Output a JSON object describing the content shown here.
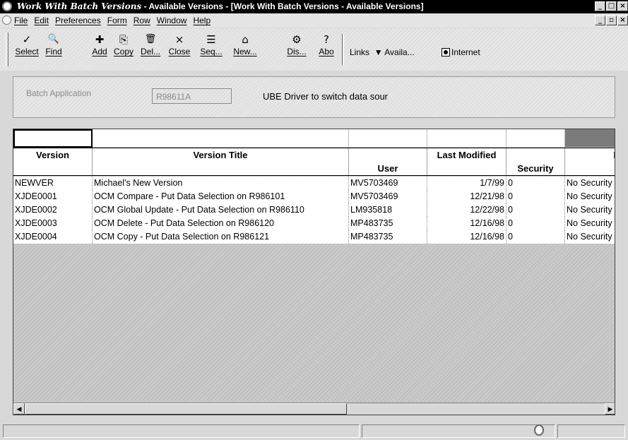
{
  "window": {
    "title_italic": "Work With Batch Versions",
    "title_rest": " - Available Versions - [Work With Batch Versions - Available Versions]",
    "outer_buttons": [
      "_",
      "□",
      "×"
    ],
    "inner_buttons": [
      "_",
      "▫",
      "×"
    ]
  },
  "menubar": {
    "items": [
      "File",
      "Edit",
      "Preferences",
      "Form",
      "Row",
      "Window",
      "Help"
    ]
  },
  "toolbar": {
    "buttons": [
      {
        "label": "Select",
        "icon": "checkmark-icon",
        "glyph": "✓"
      },
      {
        "label": "Find",
        "icon": "find-icon",
        "glyph": "🔍"
      },
      {
        "label": "Add",
        "icon": "add-icon",
        "glyph": "✚"
      },
      {
        "label": "Copy",
        "icon": "copy-icon",
        "glyph": "⎘"
      },
      {
        "label": "Del...",
        "icon": "trash-icon",
        "glyph": "🗑"
      },
      {
        "label": "Close",
        "icon": "close-icon",
        "glyph": "×"
      },
      {
        "label": "Seq...",
        "icon": "sequence-icon",
        "glyph": "☰"
      },
      {
        "label": "New...",
        "icon": "new-icon",
        "glyph": "⌂"
      },
      {
        "label": "Dis...",
        "icon": "display-icon",
        "glyph": "⚙"
      },
      {
        "label": "Abo",
        "icon": "about-icon",
        "glyph": "?"
      }
    ],
    "links_label": "Links",
    "available_label": "Availa...",
    "internet_label": "Internet"
  },
  "header": {
    "batch_label": "Batch Application",
    "batch_value": "R98611A",
    "batch_description": "UBE Driver to switch data sour"
  },
  "grid": {
    "columns": [
      "Version",
      "Version Title",
      "User",
      "Last Modified",
      "Security",
      "I"
    ],
    "rows": [
      {
        "version": "NEWVER",
        "title": "Michael's New Version",
        "user": "MV5703469",
        "modified": "1/7/99",
        "security": "0",
        "desc": "No Security"
      },
      {
        "version": "XJDE0001",
        "title": "OCM Compare - Put Data Selection on R986101",
        "user": "MV5703469",
        "modified": "12/21/98",
        "security": "0",
        "desc": "No Security"
      },
      {
        "version": "XJDE0002",
        "title": "OCM Global Update - Put Data Selection on R986110",
        "user": "LM935818",
        "modified": "12/22/98",
        "security": "0",
        "desc": "No Security"
      },
      {
        "version": "XJDE0003",
        "title": "OCM Delete - Put Data Selection on R986120",
        "user": "MP483735",
        "modified": "12/16/98",
        "security": "0",
        "desc": "No Security"
      },
      {
        "version": "XJDE0004",
        "title": "OCM Copy - Put Data Selection on R986121",
        "user": "MP483735",
        "modified": "12/16/98",
        "security": "0",
        "desc": "No Security"
      }
    ]
  },
  "colors": {
    "titlebar_bg": "#000000",
    "chrome_bg": "#d8d8d8",
    "grid_empty_bg": "#c9c9c9"
  }
}
